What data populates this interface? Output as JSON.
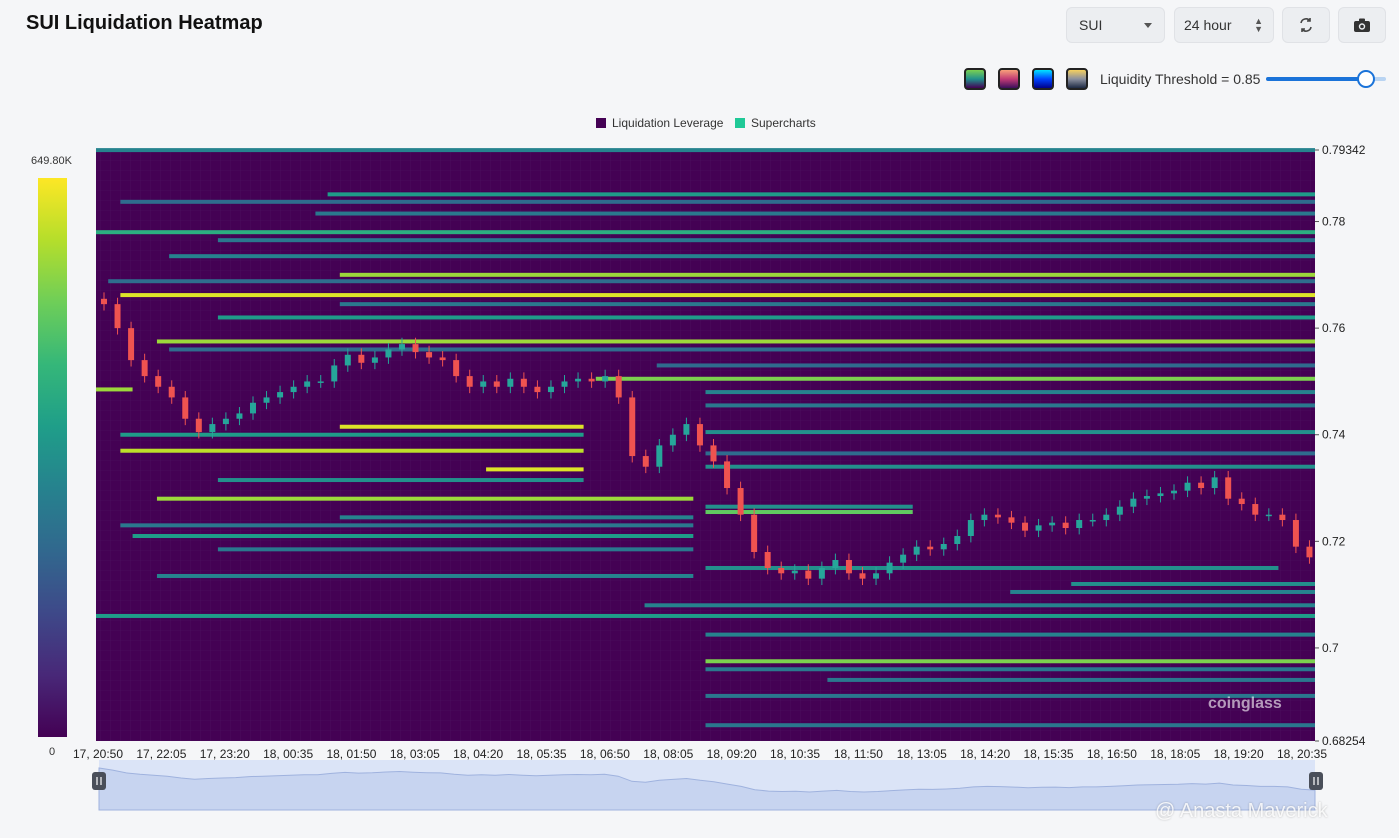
{
  "header": {
    "title": "SUI Liquidation Heatmap"
  },
  "controls": {
    "coin": "SUI",
    "range": "24 hour",
    "refresh_icon": "refresh-icon",
    "camera_icon": "camera-icon",
    "threshold_label": "Liquidity Threshold = 0.85",
    "threshold_value": 0.85
  },
  "palettes": [
    "viridis",
    "sunset",
    "rainbow",
    "grey-yellow"
  ],
  "legend": {
    "leverage": "Liquidation Leverage",
    "supercharts": "Supercharts"
  },
  "colorbar": {
    "max_label": "649.80K",
    "min_label": "0"
  },
  "watermark": "@ Anasta Maverick",
  "logo": "coinglass",
  "chart_data": {
    "type": "heatmap",
    "title": "SUI Liquidation Heatmap",
    "colors": {
      "background": "#440154",
      "high": "#fde725",
      "candle_up": "#26a69a",
      "candle_down": "#ef5350"
    },
    "y_ticks": [
      "0.79342",
      "0.78",
      "0.76",
      "0.74",
      "0.72",
      "0.7",
      "0.68254"
    ],
    "ylim": [
      0.68254,
      0.79342
    ],
    "x_ticks": [
      "17, 20:50",
      "17, 22:05",
      "17, 23:20",
      "18, 00:35",
      "18, 01:50",
      "18, 03:05",
      "18, 04:20",
      "18, 05:35",
      "18, 06:50",
      "18, 08:05",
      "18, 09:20",
      "18, 10:35",
      "18, 11:50",
      "18, 13:05",
      "18, 14:20",
      "18, 15:35",
      "18, 16:50",
      "18, 18:05",
      "18, 19:20",
      "18, 20:35"
    ],
    "price_series": [
      0.7645,
      0.76,
      0.754,
      0.751,
      0.749,
      0.747,
      0.743,
      0.7405,
      0.742,
      0.743,
      0.744,
      0.746,
      0.747,
      0.748,
      0.749,
      0.75,
      0.75,
      0.753,
      0.755,
      0.7535,
      0.7545,
      0.756,
      0.757,
      0.7555,
      0.7545,
      0.754,
      0.751,
      0.749,
      0.75,
      0.749,
      0.7505,
      0.749,
      0.748,
      0.749,
      0.75,
      0.7505,
      0.75,
      0.751,
      0.747,
      0.736,
      0.734,
      0.738,
      0.74,
      0.742,
      0.738,
      0.735,
      0.73,
      0.725,
      0.718,
      0.715,
      0.714,
      0.7145,
      0.713,
      0.715,
      0.7165,
      0.714,
      0.713,
      0.714,
      0.716,
      0.7175,
      0.719,
      0.7185,
      0.7195,
      0.721,
      0.724,
      0.725,
      0.7245,
      0.7235,
      0.722,
      0.723,
      0.7235,
      0.7225,
      0.724,
      0.724,
      0.725,
      0.7265,
      0.728,
      0.7285,
      0.729,
      0.7295,
      0.731,
      0.73,
      0.732,
      0.728,
      0.727,
      0.725,
      0.725,
      0.724,
      0.719,
      0.717
    ],
    "liquidity_bands": [
      {
        "price": 0.7934,
        "start": 0.0,
        "end": 1.0,
        "level": 0.45
      },
      {
        "price": 0.7851,
        "start": 0.19,
        "end": 1.0,
        "level": 0.55
      },
      {
        "price": 0.7837,
        "start": 0.02,
        "end": 1.0,
        "level": 0.35
      },
      {
        "price": 0.7815,
        "start": 0.18,
        "end": 1.0,
        "level": 0.4
      },
      {
        "price": 0.778,
        "start": 0.0,
        "end": 1.0,
        "level": 0.62
      },
      {
        "price": 0.7765,
        "start": 0.1,
        "end": 1.0,
        "level": 0.4
      },
      {
        "price": 0.7735,
        "start": 0.06,
        "end": 1.0,
        "level": 0.45
      },
      {
        "price": 0.77,
        "start": 0.2,
        "end": 1.0,
        "level": 0.85
      },
      {
        "price": 0.7688,
        "start": 0.01,
        "end": 1.0,
        "level": 0.35
      },
      {
        "price": 0.7662,
        "start": 0.02,
        "end": 1.0,
        "level": 0.95
      },
      {
        "price": 0.7645,
        "start": 0.2,
        "end": 1.0,
        "level": 0.4
      },
      {
        "price": 0.762,
        "start": 0.1,
        "end": 1.0,
        "level": 0.55
      },
      {
        "price": 0.7575,
        "start": 0.05,
        "end": 1.0,
        "level": 0.85
      },
      {
        "price": 0.756,
        "start": 0.06,
        "end": 1.0,
        "level": 0.35
      },
      {
        "price": 0.753,
        "start": 0.46,
        "end": 1.0,
        "level": 0.35
      },
      {
        "price": 0.7505,
        "start": 0.41,
        "end": 1.0,
        "level": 0.8
      },
      {
        "price": 0.7485,
        "start": 0.0,
        "end": 0.03,
        "level": 0.85
      },
      {
        "price": 0.748,
        "start": 0.5,
        "end": 1.0,
        "level": 0.45
      },
      {
        "price": 0.7455,
        "start": 0.5,
        "end": 1.0,
        "level": 0.4
      },
      {
        "price": 0.7415,
        "start": 0.2,
        "end": 0.4,
        "level": 0.95
      },
      {
        "price": 0.7405,
        "start": 0.5,
        "end": 1.0,
        "level": 0.5
      },
      {
        "price": 0.74,
        "start": 0.02,
        "end": 0.4,
        "level": 0.55
      },
      {
        "price": 0.737,
        "start": 0.02,
        "end": 0.4,
        "level": 0.9
      },
      {
        "price": 0.7365,
        "start": 0.5,
        "end": 1.0,
        "level": 0.35
      },
      {
        "price": 0.734,
        "start": 0.5,
        "end": 1.0,
        "level": 0.5
      },
      {
        "price": 0.7335,
        "start": 0.32,
        "end": 0.4,
        "level": 0.95
      },
      {
        "price": 0.7315,
        "start": 0.1,
        "end": 0.4,
        "level": 0.5
      },
      {
        "price": 0.728,
        "start": 0.05,
        "end": 0.49,
        "level": 0.85
      },
      {
        "price": 0.7265,
        "start": 0.5,
        "end": 0.67,
        "level": 0.5
      },
      {
        "price": 0.7255,
        "start": 0.5,
        "end": 0.67,
        "level": 0.75
      },
      {
        "price": 0.7245,
        "start": 0.2,
        "end": 0.49,
        "level": 0.45
      },
      {
        "price": 0.723,
        "start": 0.02,
        "end": 0.49,
        "level": 0.4
      },
      {
        "price": 0.721,
        "start": 0.03,
        "end": 0.49,
        "level": 0.55
      },
      {
        "price": 0.7185,
        "start": 0.1,
        "end": 0.49,
        "level": 0.4
      },
      {
        "price": 0.715,
        "start": 0.5,
        "end": 0.97,
        "level": 0.5
      },
      {
        "price": 0.7135,
        "start": 0.05,
        "end": 0.49,
        "level": 0.45
      },
      {
        "price": 0.712,
        "start": 0.8,
        "end": 1.0,
        "level": 0.5
      },
      {
        "price": 0.7105,
        "start": 0.75,
        "end": 1.0,
        "level": 0.45
      },
      {
        "price": 0.708,
        "start": 0.45,
        "end": 1.0,
        "level": 0.45
      },
      {
        "price": 0.706,
        "start": 0.0,
        "end": 1.0,
        "level": 0.55
      },
      {
        "price": 0.7025,
        "start": 0.5,
        "end": 1.0,
        "level": 0.45
      },
      {
        "price": 0.6975,
        "start": 0.5,
        "end": 1.0,
        "level": 0.8
      },
      {
        "price": 0.696,
        "start": 0.5,
        "end": 1.0,
        "level": 0.4
      },
      {
        "price": 0.694,
        "start": 0.6,
        "end": 1.0,
        "level": 0.4
      },
      {
        "price": 0.691,
        "start": 0.5,
        "end": 1.0,
        "level": 0.4
      },
      {
        "price": 0.6855,
        "start": 0.5,
        "end": 1.0,
        "level": 0.4
      }
    ]
  }
}
